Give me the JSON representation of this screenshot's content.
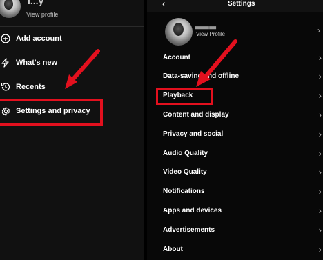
{
  "left_menu": {
    "user_name": "l...y",
    "view_profile": "View profile",
    "items": [
      {
        "label": "Add account",
        "icon": "plus-circle-icon"
      },
      {
        "label": "What's new",
        "icon": "lightning-icon"
      },
      {
        "label": "Recents",
        "icon": "history-icon"
      },
      {
        "label": "Settings and privacy",
        "icon": "gear-icon"
      }
    ]
  },
  "settings": {
    "title": "Settings",
    "view_profile": "View Profile",
    "items": [
      {
        "label": "Account"
      },
      {
        "label": "Data-saving and offline"
      },
      {
        "label": "Playback"
      },
      {
        "label": "Content and display"
      },
      {
        "label": "Privacy and social"
      },
      {
        "label": "Audio Quality"
      },
      {
        "label": "Video Quality"
      },
      {
        "label": "Notifications"
      },
      {
        "label": "Apps and devices"
      },
      {
        "label": "Advertisements"
      },
      {
        "label": "About"
      }
    ]
  },
  "colors": {
    "highlight": "#e3101e",
    "background": "#0a0a0a"
  }
}
